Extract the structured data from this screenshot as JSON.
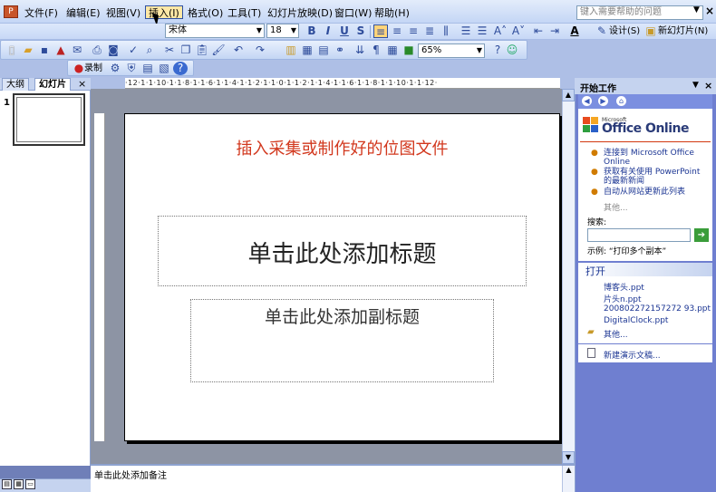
{
  "menu": {
    "items": [
      {
        "label": "文件(F)",
        "name": "file"
      },
      {
        "label": "编辑(E)",
        "name": "edit"
      },
      {
        "label": "视图(V)",
        "name": "view"
      },
      {
        "label": "插入(I)",
        "name": "insert",
        "active": true
      },
      {
        "label": "格式(O)",
        "name": "format"
      },
      {
        "label": "工具(T)",
        "name": "tools"
      },
      {
        "label": "幻灯片放映(D)",
        "name": "slideshow"
      },
      {
        "label": "窗口(W)",
        "name": "window"
      },
      {
        "label": "帮助(H)",
        "name": "help"
      }
    ],
    "help_placeholder": "键入需要帮助的问题"
  },
  "toolbar": {
    "font_name": "宋体",
    "font_size": "18",
    "bold": "B",
    "italic": "I",
    "underline": "U",
    "shadow": "S",
    "design": "设计(S)",
    "new_slide": "新幻灯片(N)",
    "zoom": "65%",
    "record": "录制"
  },
  "left_pane": {
    "tab_outline": "大纲",
    "tab_slides": "幻灯片",
    "slide_number": "1"
  },
  "ruler": {
    "horizontal": "·12·1·1·10·1·1·8·1·1·6·1·1·4·1·1·2·1·1·0·1·1·2·1·1·4·1·1·6·1·1·8·1·1·10·1·1·12·"
  },
  "slide": {
    "picture_title": "插入采集或制作好的位图文件",
    "title_placeholder": "单击此处添加标题",
    "subtitle_placeholder": "单击此处添加副标题"
  },
  "notes": {
    "placeholder": "单击此处添加备注"
  },
  "task_pane": {
    "title": "开始工作",
    "office_small": "Microsoft",
    "office_online": "Office Online",
    "links": [
      "连接到 Microsoft Office Online",
      "获取有关使用 PowerPoint 的最新新闻",
      "自动从网站更新此列表"
    ],
    "more": "其他...",
    "search_label": "搜索:",
    "example": "示例: “打印多个副本”",
    "open_title": "打开",
    "files": [
      "博客头.ppt",
      "片头n.ppt",
      "200802272157272 93.ppt",
      "DigitalClock.ppt"
    ],
    "open_more": "其他...",
    "new_presentation": "新建演示文稿..."
  },
  "colors": {
    "slide_title": "#d2381e",
    "link": "#1b3593",
    "taskpane_bg": "#6f7fd0"
  }
}
